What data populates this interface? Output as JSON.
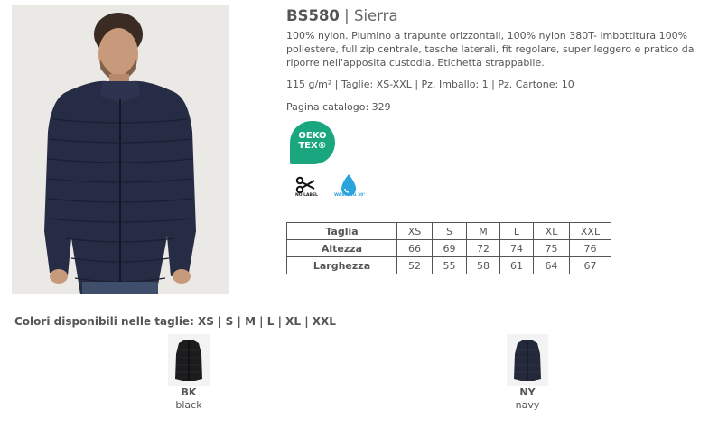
{
  "product": {
    "code": "BS580",
    "separator": " | ",
    "name": "Sierra",
    "description": "100% nylon. Piumino a trapunte orizzontali, 100% nylon 380T- imbottitura 100% poliestere, full zip centrale, tasche laterali, fit regolare, super leggero e pratico da riporre nell'apposita custodia. Etichetta strappabile.",
    "specs": "115 g/m² | Taglie: XS-XXL | Pz. Imballo: 1 | Pz. Cartone: 10",
    "catalog_page": "Pagina catalogo: 329"
  },
  "badges": {
    "oeko_line1": "OEKO",
    "oeko_line2": "TEX®",
    "no_label": "NO LABEL",
    "washing": "WASHING 30°"
  },
  "size_table": {
    "headers": [
      "Taglia",
      "XS",
      "S",
      "M",
      "L",
      "XL",
      "XXL"
    ],
    "rows": [
      {
        "label": "Altezza",
        "values": [
          "66",
          "69",
          "72",
          "74",
          "75",
          "76"
        ]
      },
      {
        "label": "Larghezza",
        "values": [
          "52",
          "55",
          "58",
          "61",
          "64",
          "67"
        ]
      }
    ]
  },
  "colors": {
    "title": "Colori disponibili nelle taglie: XS | S | M | L | XL | XXL",
    "items": [
      {
        "code": "BK",
        "name": "black",
        "hex": "#1c1c1e"
      },
      {
        "code": "NY",
        "name": "navy",
        "hex": "#23283a"
      }
    ]
  },
  "palette": {
    "jacket": "#272c45",
    "oeko": "#1aa780",
    "washing": "#2ba3dc"
  }
}
